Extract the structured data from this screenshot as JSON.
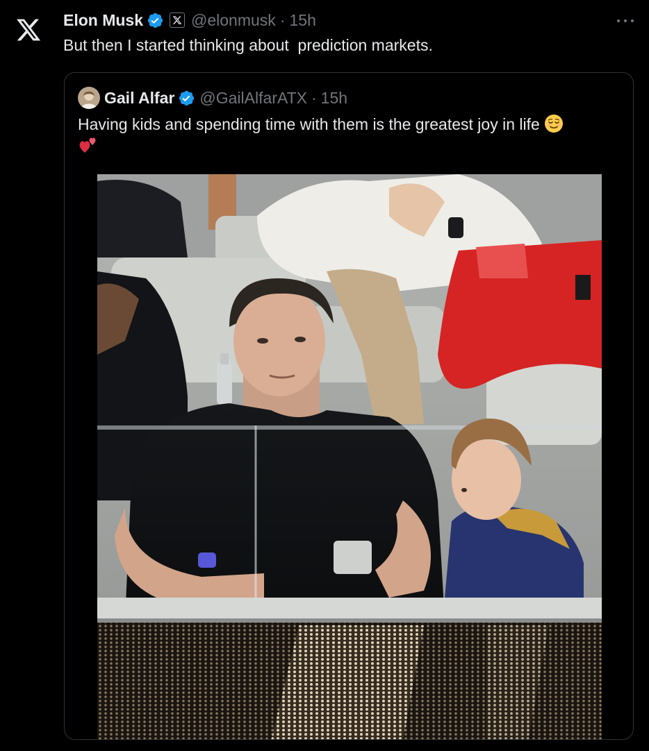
{
  "icons": {
    "app_logo": "x-logo-icon",
    "verified": "verified-badge-icon",
    "affiliate": "x-affiliate-badge-icon",
    "more": "more-options-icon"
  },
  "colors": {
    "background": "#000000",
    "text_primary": "#e7e9ea",
    "text_secondary": "#71767b",
    "verified_blue": "#1d9bf0",
    "card_border": "#2f3336"
  },
  "tweet": {
    "author_name": "Elon Musk",
    "handle": "@elonmusk",
    "separator": "·",
    "time": "15h",
    "text": "But then I started thinking about  prediction markets."
  },
  "quoted_tweet": {
    "author_name": "Gail Alfar",
    "handle": "@GailAlfarATX",
    "separator": "·",
    "time": "15h",
    "text": "Having kids and spending time with them is the greatest joy in life",
    "emojis": [
      "relieved-face-emoji",
      "two-hearts-emoji"
    ],
    "media": "photo-man-and-child-in-stadium-suite"
  }
}
